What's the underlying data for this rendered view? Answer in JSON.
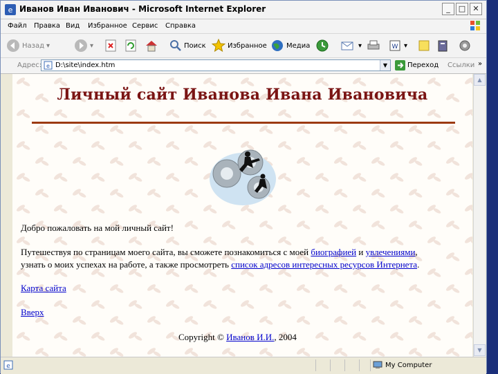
{
  "window": {
    "title": "Иванов Иван Иванович - Microsoft Internet Explorer",
    "minimize_label": "_",
    "maximize_label": "□",
    "close_label": "✕"
  },
  "menu": [
    "Файл",
    "Правка",
    "Вид",
    "Избранное",
    "Сервис",
    "Справка"
  ],
  "toolbar": {
    "back_label": "Назад",
    "search_label": "Поиск",
    "favorites_label": "Избранное",
    "media_label": "Медиа"
  },
  "address": {
    "label": "Адрес:",
    "value": "D:\\site\\index.htm",
    "go_label": "Переход",
    "links_label": "Ссылки"
  },
  "page": {
    "heading": "Личный сайт Иванова Ивана Ивановича",
    "welcome": "Добро пожаловать на мой личный сайт!",
    "intro_part1": "Путешествуя по страницам моего сайта, вы сможете познакомиться с моей ",
    "link_biography": "биографией",
    "intro_and": " и ",
    "link_hobbies": "увлечениями",
    "intro_comma": ",",
    "intro_part2": "узнать о моих успехах на работе, а также просмотреть ",
    "link_resources": "список адресов интересных ресурсов Интернета",
    "intro_period": ".",
    "link_sitemap": "Карта сайта",
    "link_top": "Вверх",
    "copyright_prefix": "Copyright © ",
    "copyright_name": "Иванов И.И.",
    "copyright_suffix": ", 2004"
  },
  "status": {
    "zone_label": "My Computer"
  },
  "colors": {
    "heading": "#7a1414",
    "rule": "#9c3a12",
    "link": "#0000cc"
  }
}
